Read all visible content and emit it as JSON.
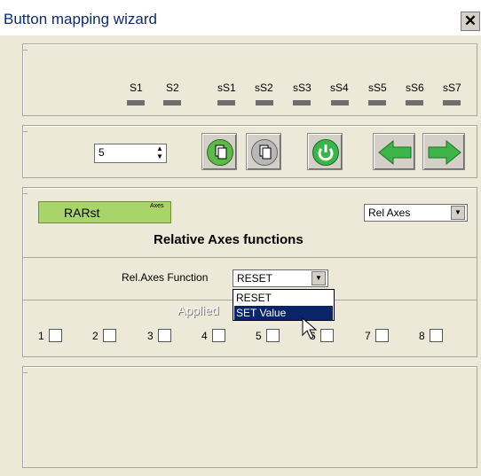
{
  "window": {
    "title": "Button mapping wizard",
    "close_glyph": "✕"
  },
  "slots": [
    "S1",
    "S2",
    "sS1",
    "sS2",
    "sS3",
    "sS4",
    "sS5",
    "sS6",
    "sS7"
  ],
  "toolbar": {
    "number_value": "5",
    "spin_up": "▲",
    "spin_down": "▼",
    "icons": [
      "copy-green-icon",
      "paste-gray-icon",
      "refresh-icon",
      "arrow-left-icon",
      "arrow-right-icon"
    ]
  },
  "axes_panel": {
    "button_label": "RARst",
    "button_badge": "Axes",
    "mode_select": "Rel Axes",
    "heading": "Relative Axes functions",
    "function_label": "Rel.Axes Function",
    "function_value": "RESET",
    "dropdown_options": [
      "RESET",
      "SET Value"
    ],
    "applied_label": "Applied",
    "checkbox_labels": [
      "1",
      "2",
      "3",
      "4",
      "5",
      "6",
      "7",
      "8"
    ]
  },
  "colors": {
    "accent_green": "#a9d46a",
    "selected_bg": "#0a246a",
    "title_text": "#0b2a7a"
  }
}
